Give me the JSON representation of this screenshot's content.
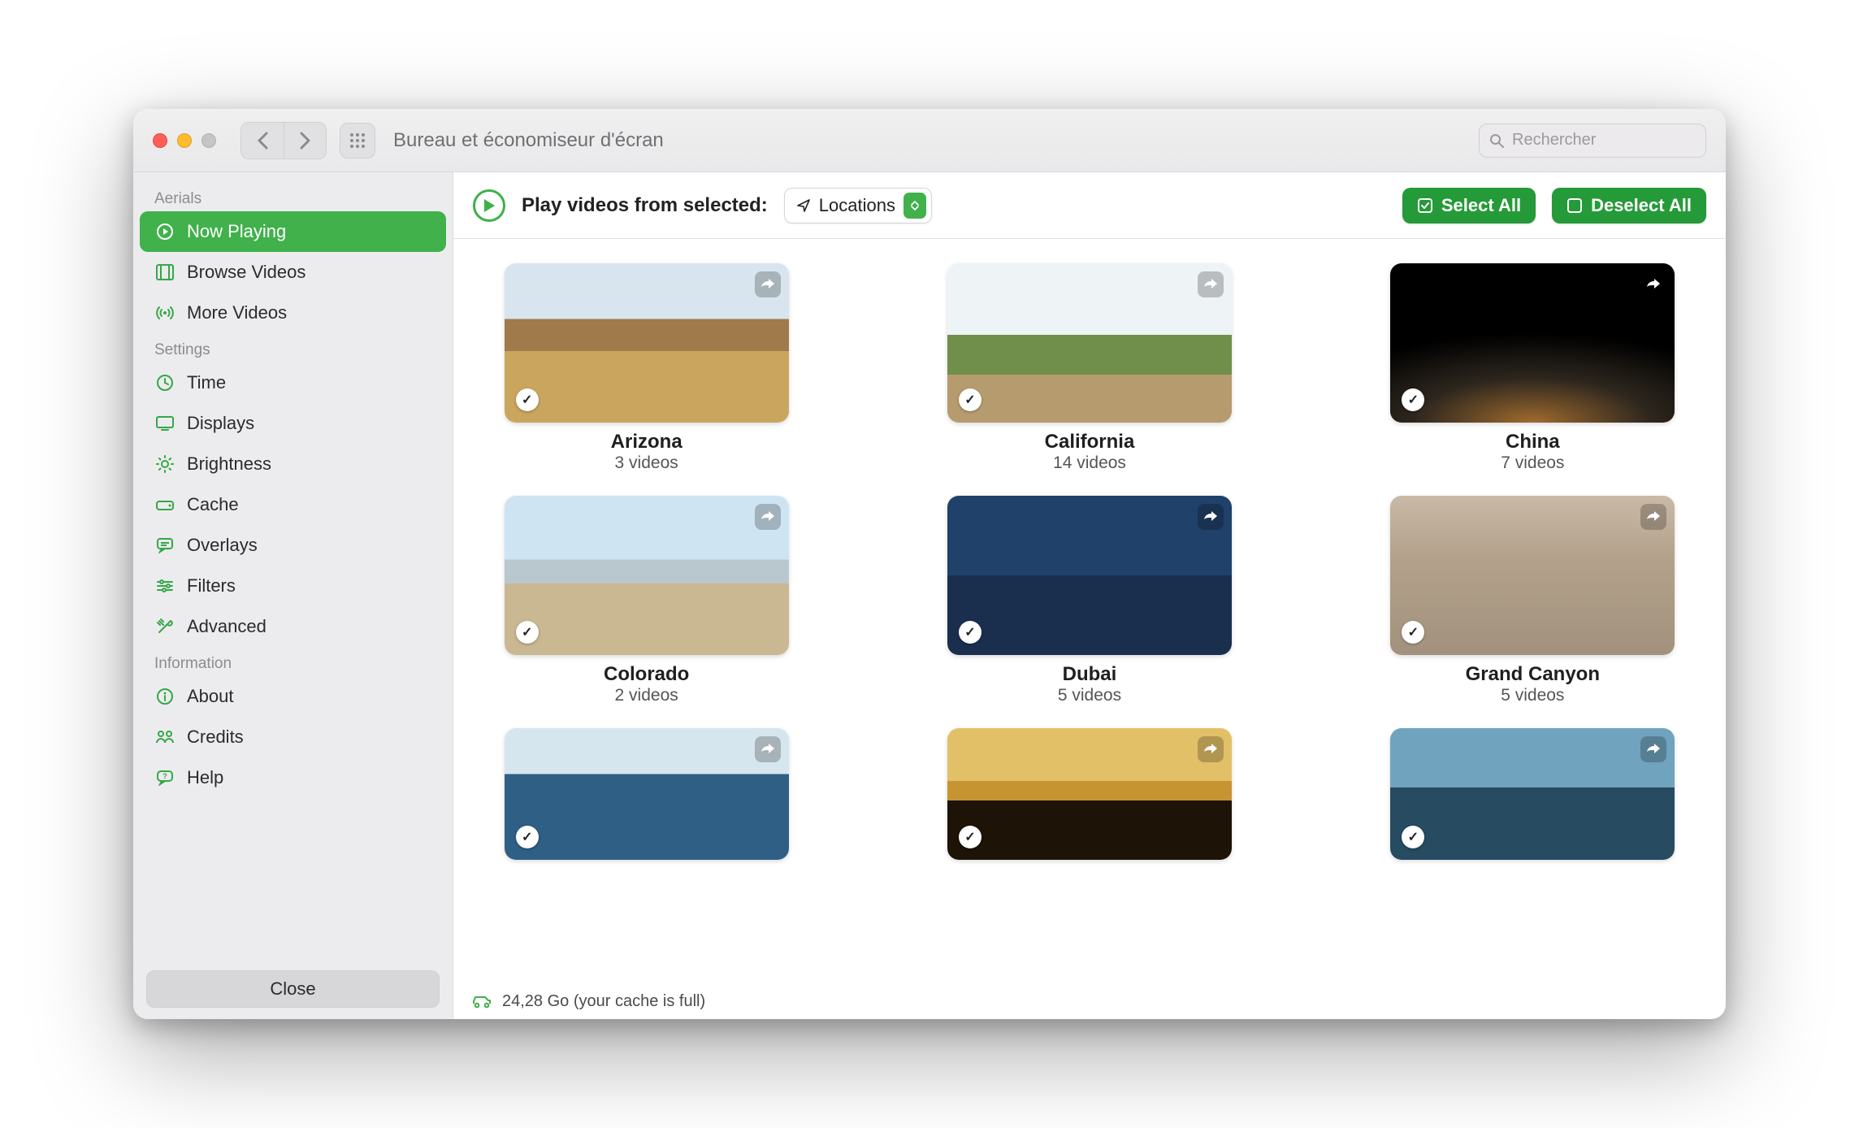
{
  "window": {
    "title": "Bureau et économiseur d'écran",
    "search_placeholder": "Rechercher"
  },
  "sidebar": {
    "sections": [
      {
        "label": "Aerials"
      },
      {
        "label": "Settings"
      },
      {
        "label": "Information"
      }
    ],
    "items": {
      "now_playing": {
        "label": "Now Playing",
        "active": true
      },
      "browse": {
        "label": "Browse Videos",
        "active": false
      },
      "more": {
        "label": "More Videos",
        "active": false
      },
      "time": {
        "label": "Time"
      },
      "displays": {
        "label": "Displays"
      },
      "brightness": {
        "label": "Brightness"
      },
      "cache": {
        "label": "Cache"
      },
      "overlays": {
        "label": "Overlays"
      },
      "filters": {
        "label": "Filters"
      },
      "advanced": {
        "label": "Advanced"
      },
      "about": {
        "label": "About"
      },
      "credits": {
        "label": "Credits"
      },
      "help": {
        "label": "Help"
      }
    },
    "close_label": "Close"
  },
  "toolbar": {
    "play_label": "Play videos from selected:",
    "mode_label": "Locations",
    "select_all_label": "Select All",
    "deselect_all_label": "Deselect All"
  },
  "locations": [
    {
      "title": "Arizona",
      "sub": "3 videos",
      "bg": "bg-arizona",
      "checked": true
    },
    {
      "title": "California",
      "sub": "14 videos",
      "bg": "bg-california",
      "checked": true
    },
    {
      "title": "China",
      "sub": "7 videos",
      "bg": "bg-china",
      "checked": true
    },
    {
      "title": "Colorado",
      "sub": "2 videos",
      "bg": "bg-colorado",
      "checked": true
    },
    {
      "title": "Dubai",
      "sub": "5 videos",
      "bg": "bg-dubai",
      "checked": true
    },
    {
      "title": "Grand Canyon",
      "sub": "5 videos",
      "bg": "bg-gc",
      "checked": true
    },
    {
      "title": "",
      "sub": "",
      "bg": "bg-ice",
      "checked": true
    },
    {
      "title": "",
      "sub": "",
      "bg": "bg-sunset",
      "checked": true
    },
    {
      "title": "",
      "sub": "",
      "bg": "bg-hk",
      "checked": true
    }
  ],
  "status": {
    "text": "24,28 Go (your cache is full)"
  }
}
